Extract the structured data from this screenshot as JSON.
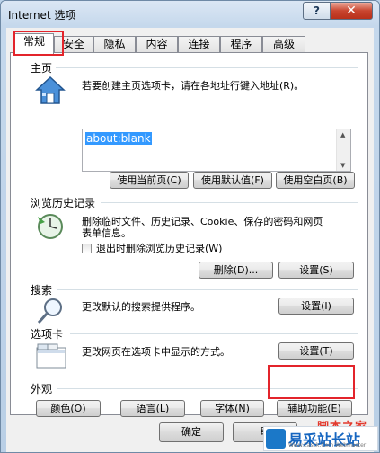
{
  "window": {
    "title": "Internet 选项",
    "help_glyph": "?",
    "close_glyph": "✕"
  },
  "tabs": [
    {
      "label": "常规",
      "active": true
    },
    {
      "label": "安全"
    },
    {
      "label": "隐私"
    },
    {
      "label": "内容"
    },
    {
      "label": "连接"
    },
    {
      "label": "程序"
    },
    {
      "label": "高级"
    }
  ],
  "home": {
    "title": "主页",
    "description": "若要创建主页选项卡，请在各地址行键入地址(R)。",
    "address_value": "about:blank",
    "buttons": [
      "使用当前页(C)",
      "使用默认值(F)",
      "使用空白页(B)"
    ]
  },
  "history": {
    "title": "浏览历史记录",
    "description_line1": "删除临时文件、历史记录、Cookie、保存的密码和网页",
    "description_line2": "表单信息。",
    "checkbox_label": "退出时删除浏览历史记录(W)",
    "checkbox_checked": false,
    "delete_button": "删除(D)...",
    "settings_button": "设置(S)"
  },
  "search": {
    "title": "搜索",
    "description": "更改默认的搜索提供程序。",
    "settings_button": "设置(I)"
  },
  "tabs_section": {
    "title": "选项卡",
    "description": "更改网页在选项卡中显示的方式。",
    "settings_button": "设置(T)"
  },
  "appearance": {
    "title": "外观",
    "buttons": [
      "颜色(O)",
      "语言(L)",
      "字体(N)",
      "辅助功能(E)"
    ]
  },
  "dialog_buttons": {
    "ok": "确定",
    "cancel": "取"
  },
  "watermark": {
    "top_text": "脚本之家",
    "name": "易采站长站",
    "url": "Www.Easck.Com Webmaster"
  },
  "colors": {
    "highlight": "#e3242b",
    "selection": "#3399ff"
  }
}
